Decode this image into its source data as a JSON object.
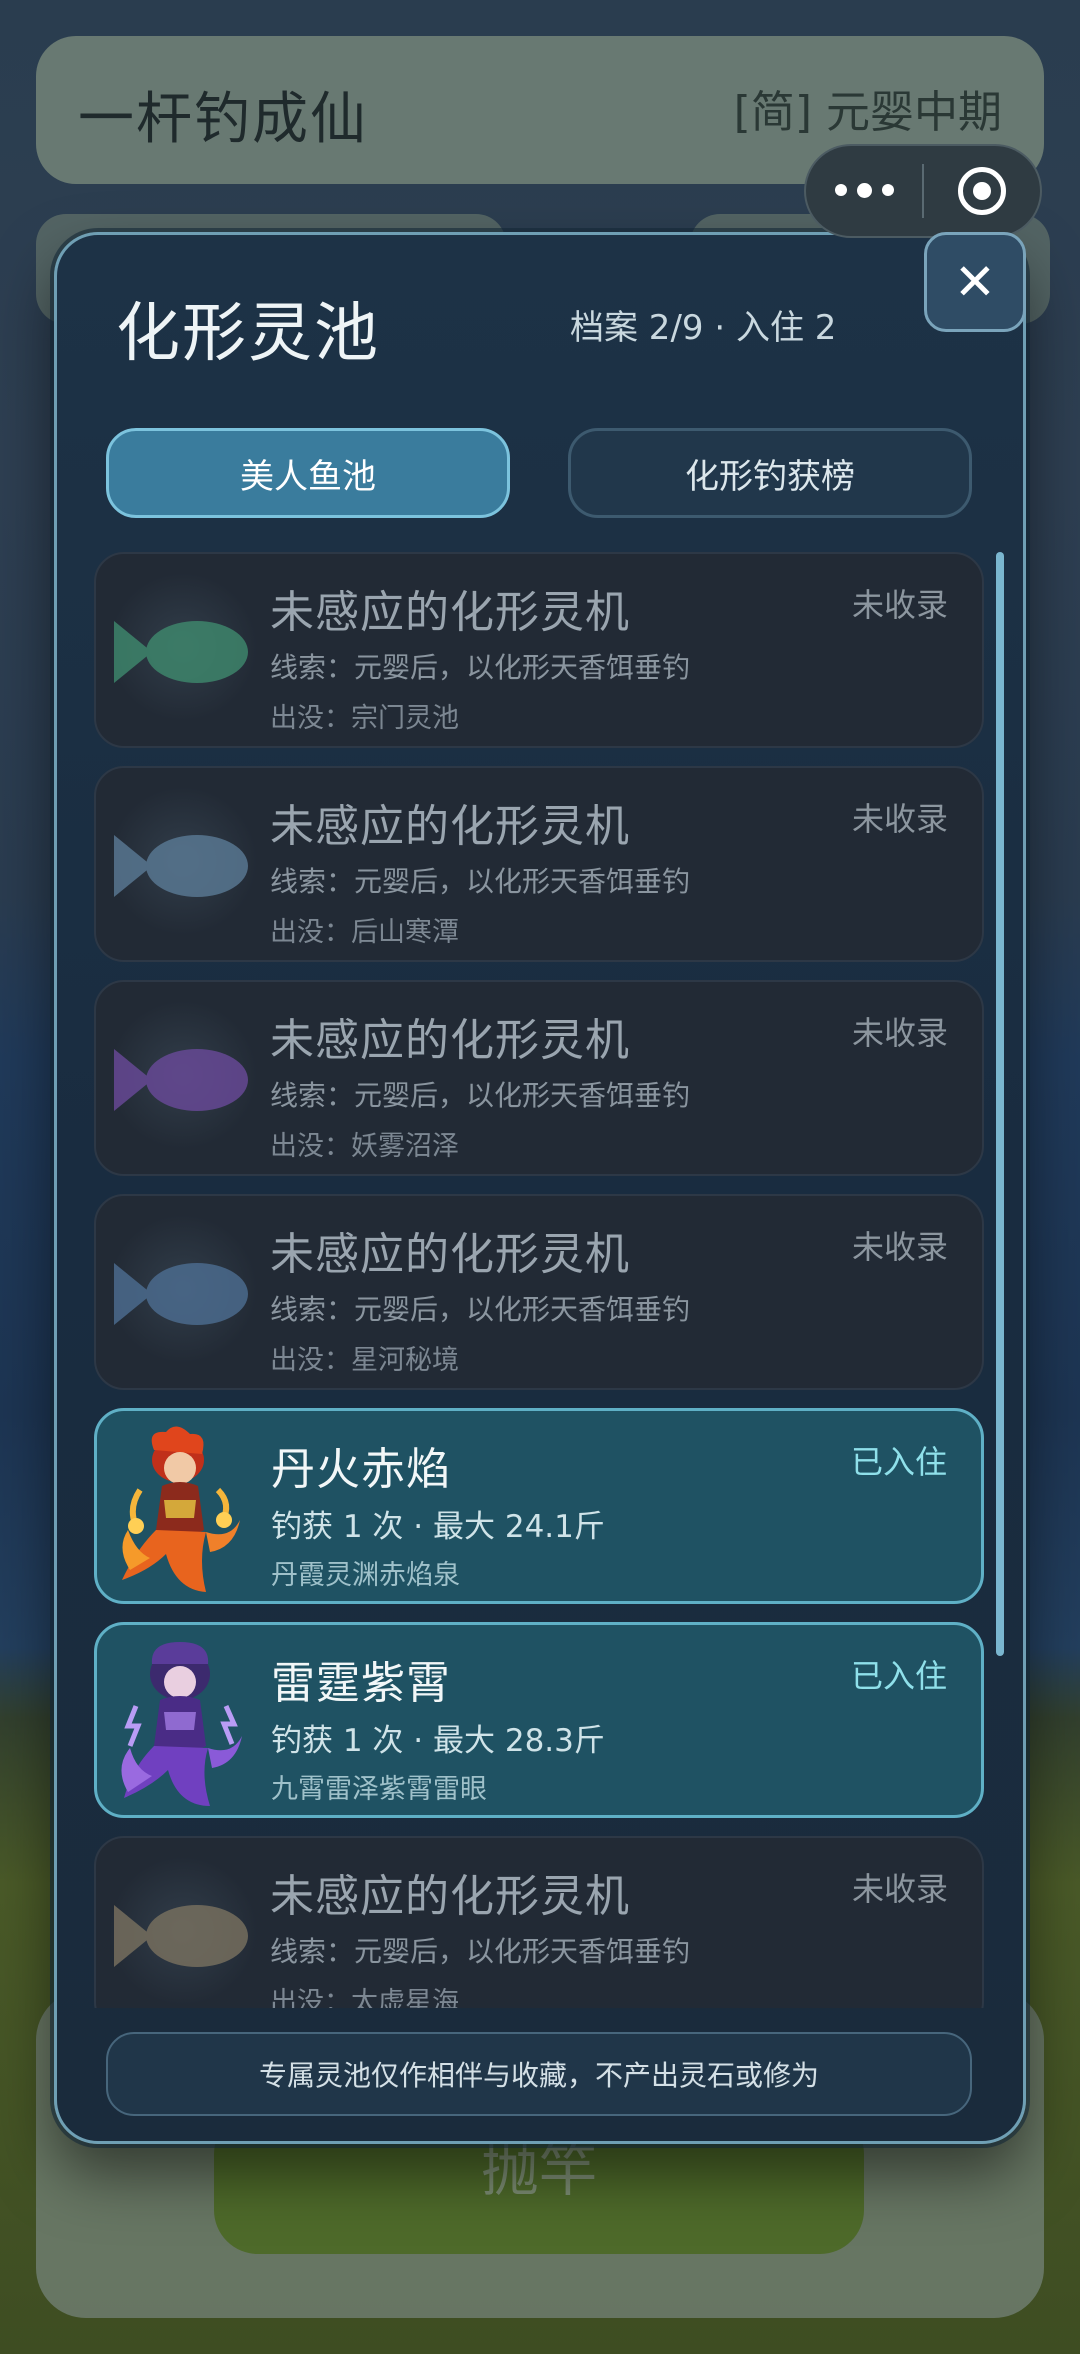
{
  "background": {
    "game_title": "一杆钓成仙",
    "realm": "[简] 元婴中期",
    "cast_button": "抛竿"
  },
  "modal": {
    "title": "化形灵池",
    "stats": "档案 2/9 · 入住 2",
    "close_label": "✕",
    "tabs": [
      {
        "label": "美人鱼池",
        "active": true
      },
      {
        "label": "化形钓获榜",
        "active": false
      }
    ],
    "entries": [
      {
        "name": "未感应的化形灵机",
        "status": "未收录",
        "line1": "线索：元婴后，以化形天香饵垂钓",
        "line2": "出没：宗门灵池",
        "owned": false,
        "fish_color": "#3f8a6e"
      },
      {
        "name": "未感应的化形灵机",
        "status": "未收录",
        "line1": "线索：元婴后，以化形天香饵垂钓",
        "line2": "出没：后山寒潭",
        "owned": false,
        "fish_color": "#5b7b96"
      },
      {
        "name": "未感应的化形灵机",
        "status": "未收录",
        "line1": "线索：元婴后，以化形天香饵垂钓",
        "line2": "出没：妖雾沼泽",
        "owned": false,
        "fish_color": "#6a4a9a"
      },
      {
        "name": "未感应的化形灵机",
        "status": "未收录",
        "line1": "线索：元婴后，以化形天香饵垂钓",
        "line2": "出没：星河秘境",
        "owned": false,
        "fish_color": "#4d6e92"
      },
      {
        "name": "丹火赤焰",
        "status": "已入住",
        "line1": "钓获 1 次 · 最大 24.1斤",
        "line2": "丹霞灵渊赤焰泉",
        "owned": true,
        "portrait": "fire-mermaid"
      },
      {
        "name": "雷霆紫霄",
        "status": "已入住",
        "line1": "钓获 1 次 · 最大 28.3斤",
        "line2": "九霄雷泽紫霄雷眼",
        "owned": true,
        "portrait": "thunder-mermaid"
      },
      {
        "name": "未感应的化形灵机",
        "status": "未收录",
        "line1": "线索：元婴后，以化形天香饵垂钓",
        "line2": "出没：太虚星海",
        "owned": false,
        "fish_color": "#7a7260"
      }
    ],
    "footer_note": "专属灵池仅作相伴与收藏，不产出灵石或修为"
  }
}
